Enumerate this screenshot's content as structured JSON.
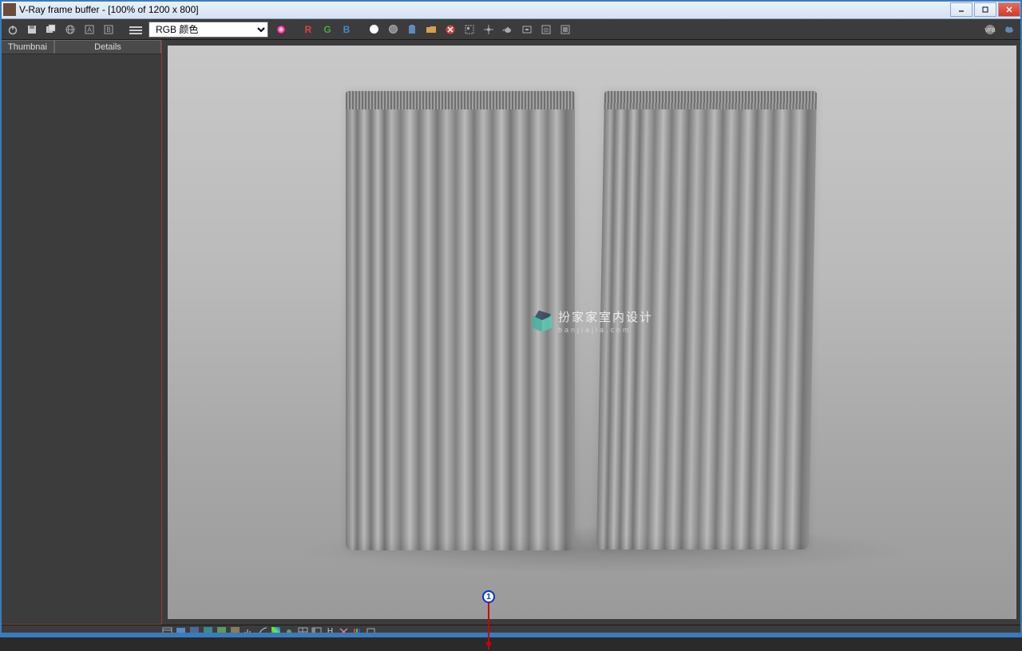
{
  "window": {
    "title": "V-Ray frame buffer - [100% of 1200 x 800]"
  },
  "toolbar": {
    "channel_dropdown": "RGB 颜色",
    "r": "R",
    "g": "G",
    "b": "B"
  },
  "sidebar": {
    "tabs": [
      "Thumbnai",
      "Details"
    ]
  },
  "watermark": {
    "title": "扮家家室内设计",
    "subtitle": "banjiajia.com"
  },
  "annotation": {
    "badge": "1"
  },
  "bottom_icons": [
    "window-icon",
    "monitor-icon",
    "swatch-blue-icon",
    "swatch-teal-icon",
    "swatch-green-icon",
    "swatch-brown-icon",
    "levels-icon",
    "curves-icon",
    "hue-icon",
    "exposure-icon",
    "grid-icon",
    "panel-icon",
    "h-icon",
    "crop-icon",
    "bars-icon",
    "square-icon"
  ]
}
